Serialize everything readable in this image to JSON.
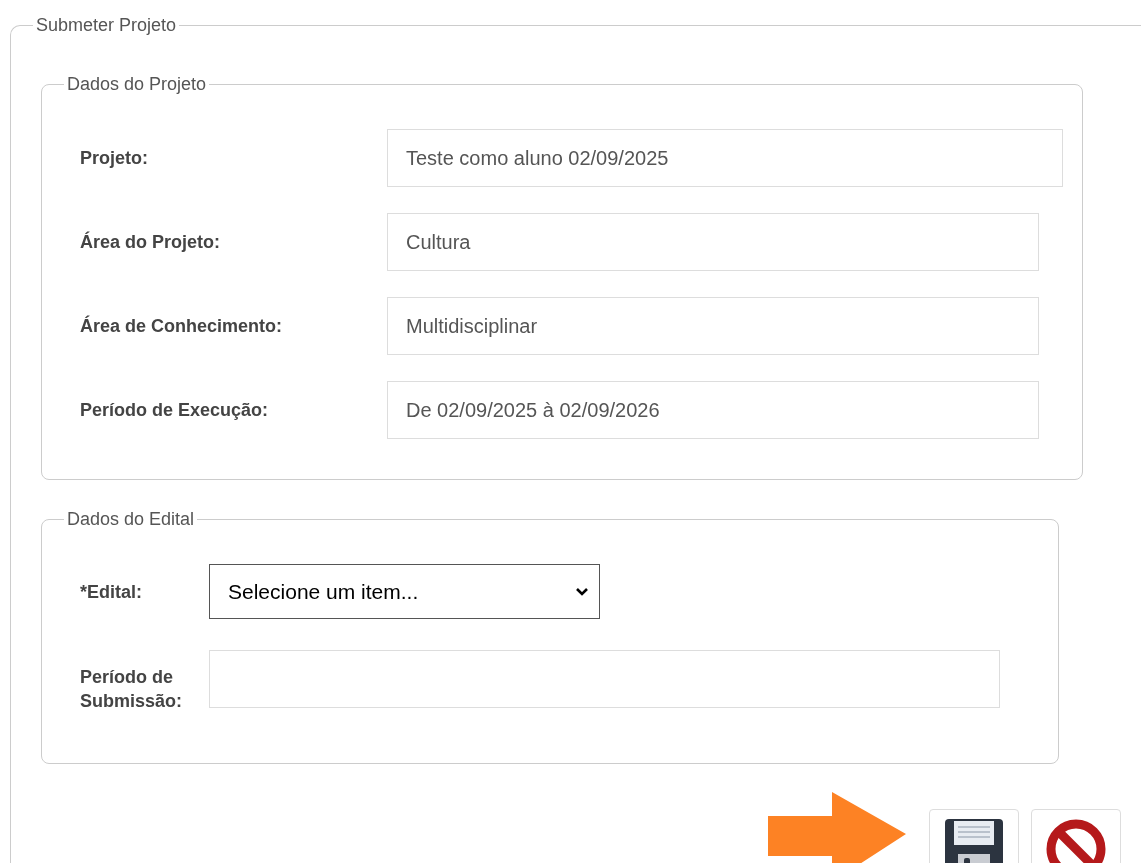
{
  "section": {
    "title": "Submeter Projeto"
  },
  "project_data": {
    "title": "Dados do Projeto",
    "rows": [
      {
        "label": "Projeto:",
        "value": "Teste como aluno 02/09/2025"
      },
      {
        "label": "Área do Projeto:",
        "value": "Cultura"
      },
      {
        "label": "Área de Conhecimento:",
        "value": "Multidisciplinar"
      },
      {
        "label": "Período de Execução:",
        "value": "De 02/09/2025 à 02/09/2026"
      }
    ]
  },
  "notice_data": {
    "title": "Dados do Edital",
    "edital": {
      "label": "*Edital:",
      "value": "Selecione um item..."
    },
    "submission_period": {
      "label": "Período de Submissão:"
    }
  },
  "buttons": [
    {
      "kind": "save"
    },
    {
      "kind": "cancel"
    }
  ]
}
